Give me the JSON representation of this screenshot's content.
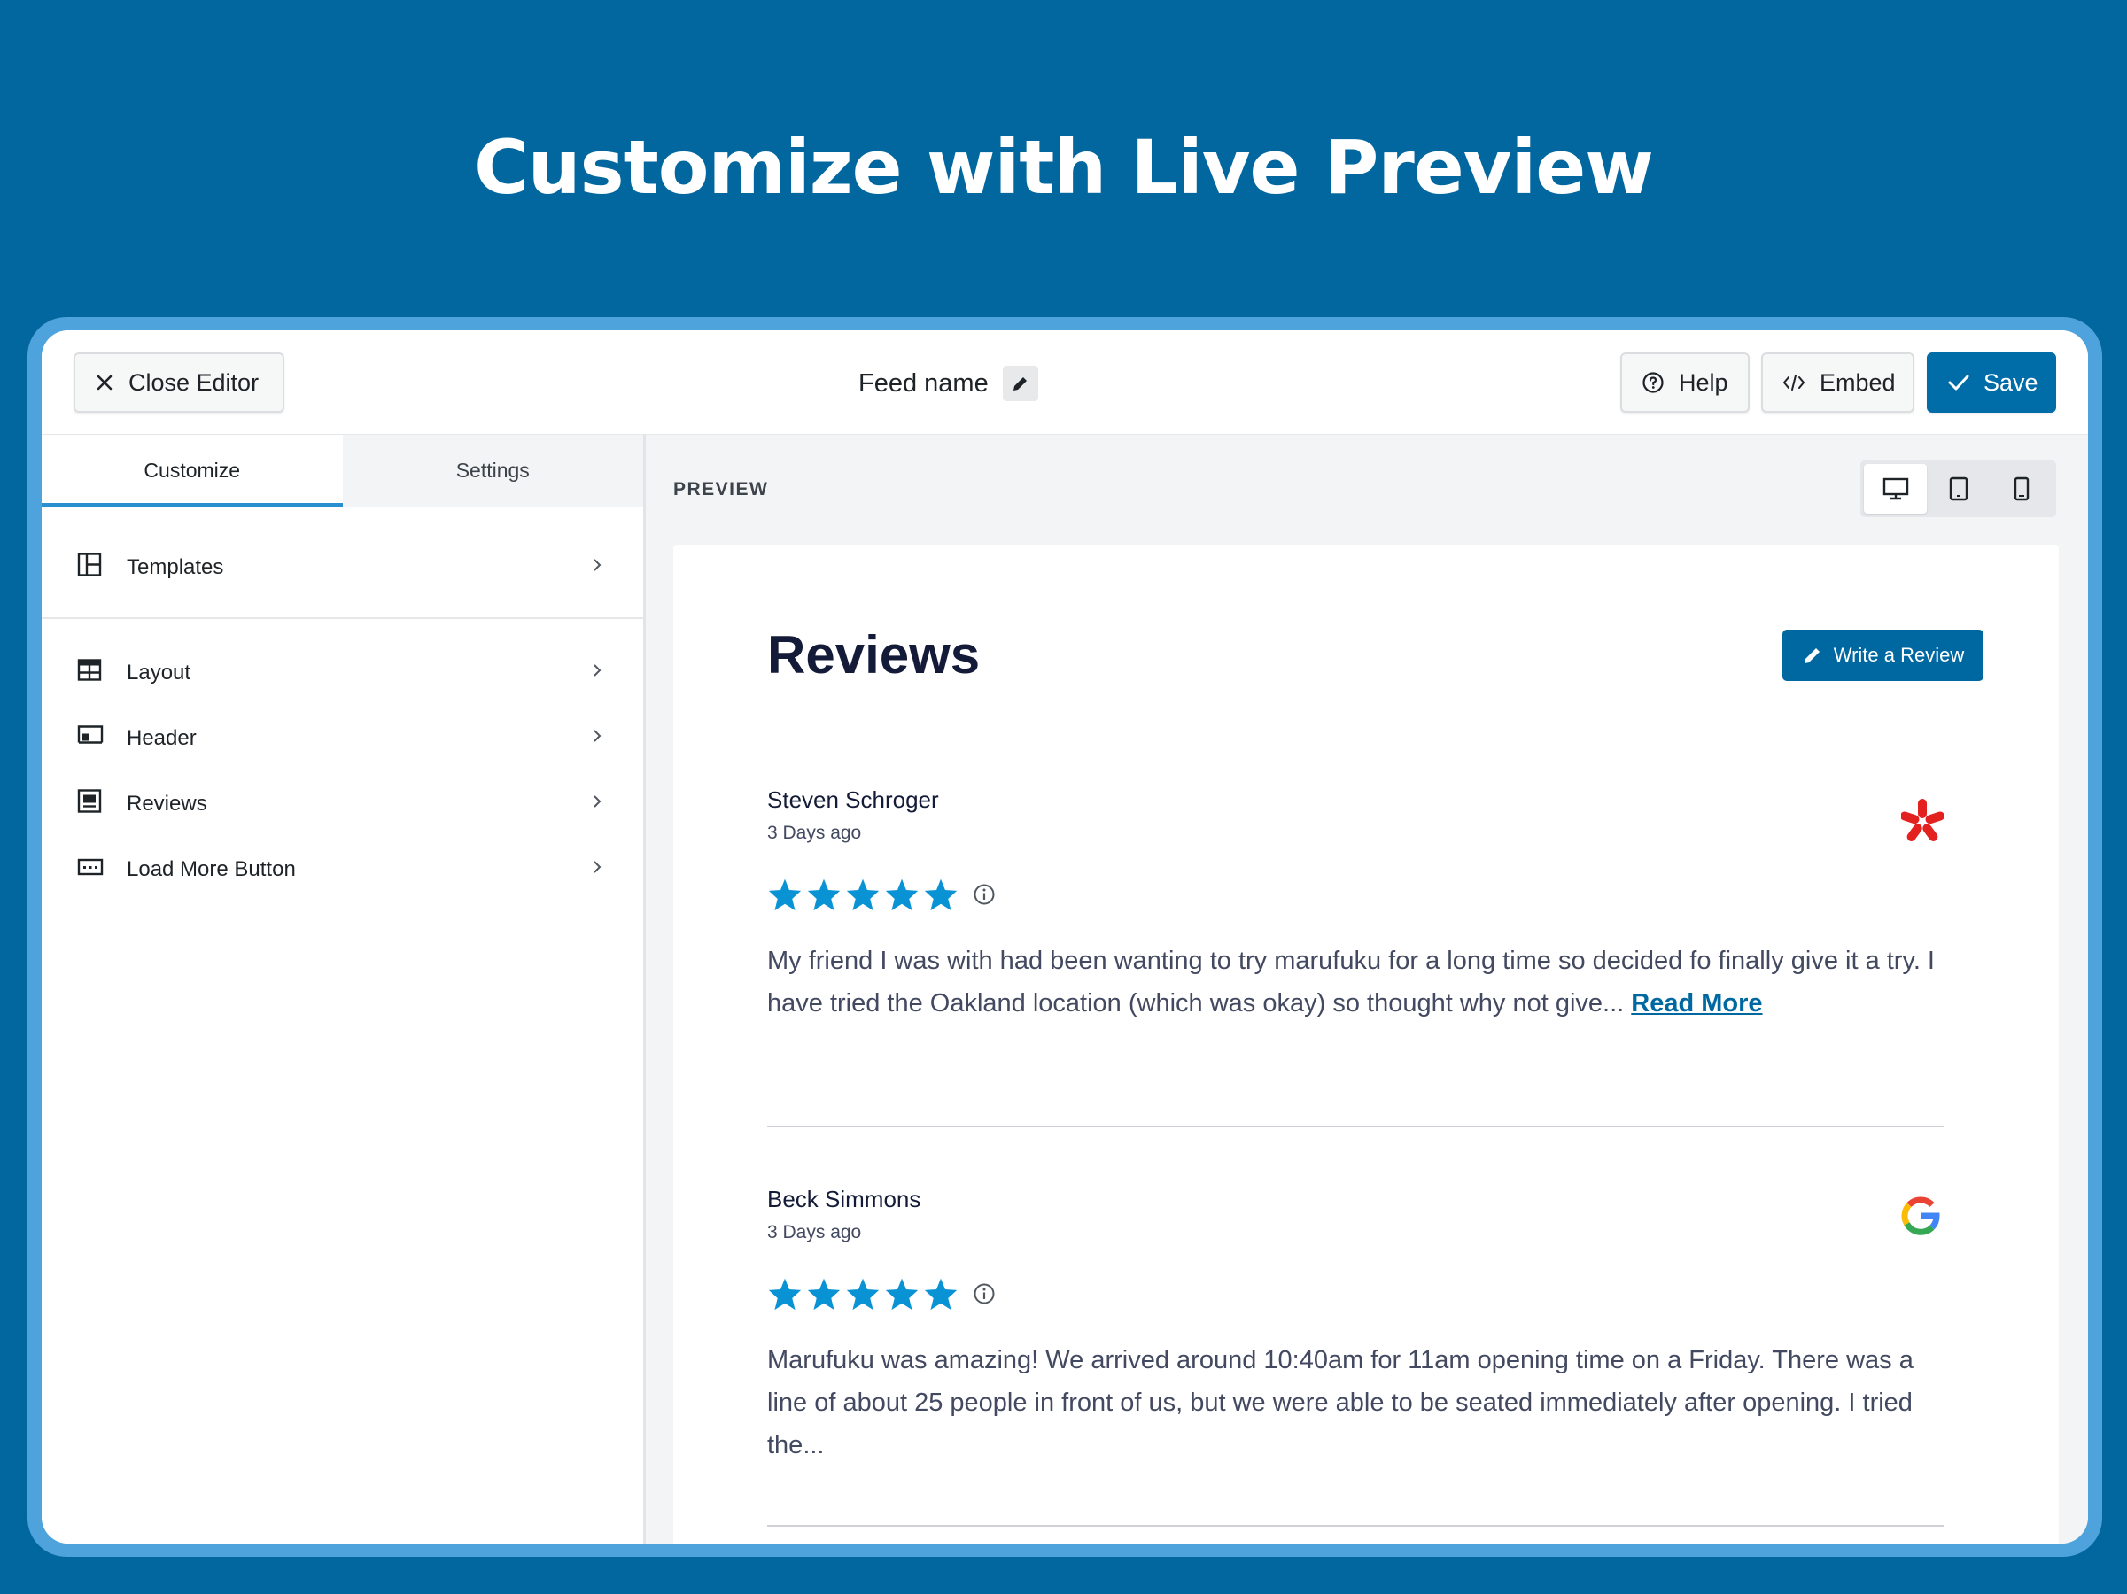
{
  "hero": {
    "title": "Customize with Live Preview"
  },
  "topbar": {
    "close_label": "Close Editor",
    "feed_name": "Feed name",
    "help_label": "Help",
    "embed_label": "Embed",
    "save_label": "Save"
  },
  "sidebar": {
    "tabs": [
      {
        "label": "Customize",
        "active": true
      },
      {
        "label": "Settings",
        "active": false
      }
    ],
    "items": [
      {
        "label": "Templates",
        "icon": "templates-icon"
      },
      {
        "label": "Layout",
        "icon": "layout-icon"
      },
      {
        "label": "Header",
        "icon": "header-icon"
      },
      {
        "label": "Reviews",
        "icon": "reviews-icon"
      },
      {
        "label": "Load More Button",
        "icon": "load-more-icon"
      }
    ]
  },
  "preview": {
    "label": "PREVIEW",
    "devices": [
      "desktop-icon",
      "tablet-icon",
      "mobile-icon"
    ],
    "active_device": "desktop",
    "title": "Reviews",
    "write_review_label": "Write a Review",
    "reviews": [
      {
        "name": "Steven Schroger",
        "date": "3 Days ago",
        "rating": 5,
        "source": "yelp",
        "text": "My friend I was with had been wanting to try marufuku for a long time so decided fo finally give it a try. I have tried the Oakland location (which was okay) so thought why not give...",
        "read_more": "Read More"
      },
      {
        "name": "Beck Simmons",
        "date": "3 Days ago",
        "rating": 5,
        "source": "google",
        "text": "Marufuku was amazing! We arrived around 10:40am for 11am opening time on a Friday. There was a line of about 25 people in front of us, but we were able to be seated immediately after opening. I tried the..."
      }
    ]
  },
  "colors": {
    "background": "#02679f",
    "accent": "#006ca8",
    "star": "#0a93d4",
    "yelp": "#e3211e"
  }
}
